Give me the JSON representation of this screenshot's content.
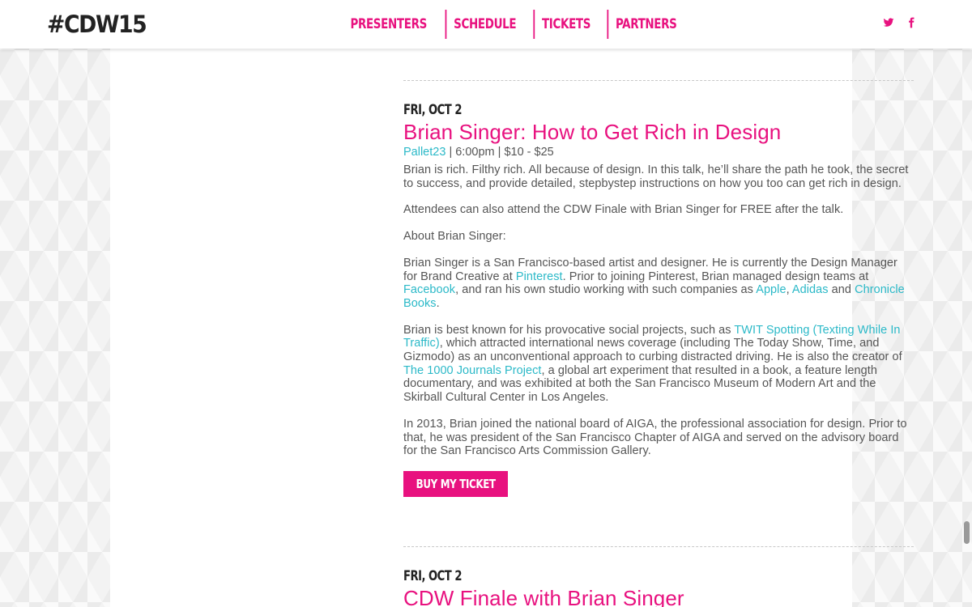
{
  "header": {
    "logo": "#CDW15",
    "nav": [
      "PRESENTERS",
      "SCHEDULE",
      "TICKETS",
      "PARTNERS"
    ],
    "social": [
      "twitter-icon",
      "facebook-icon"
    ]
  },
  "colors": {
    "accent": "#e8117f",
    "link": "#2bb9c8",
    "text": "#555555"
  },
  "events": [
    {
      "date": "FRI, OCT 2",
      "title": "Brian Singer: How to Get Rich in Design",
      "venue": "Pallet23",
      "time": "6:00pm",
      "price": "$10 - $25",
      "description_1": "Brian is rich. Filthy rich. All because of design. In this talk, he’ll share the path he took, the secret to success, and provide detailed, stepbystep instructions on how you too can get rich in design.",
      "description_2": "Attendees can also attend the CDW Finale with Brian Singer for FREE after the talk.",
      "about_heading": "About Brian Singer:",
      "bio_1": {
        "t1": "Brian Singer is a San Francisco-based artist and designer. He is currently the Design Manager for Brand Creative at ",
        "l1": "Pinterest",
        "t2": ". Prior to joining Pinterest, Brian managed design teams at ",
        "l2": "Facebook",
        "t3": ", and ran his own studio working with such companies as ",
        "l3": "Apple",
        "t4": ", ",
        "l4": "Adidas",
        "t5": " and ",
        "l5": "Chronicle Books",
        "t6": "."
      },
      "bio_2": {
        "t1": "Brian is best known for his provocative social projects, such as ",
        "l1": "TWIT Spotting (Texting While In Traffic)",
        "t2": ", which attracted international news coverage (including The Today Show, Time, and Gizmodo) as an unconventional approach to curbing distracted driving. He is also the creator of ",
        "l2": "The 1000 Journals Project",
        "t3": ", a global art experiment that resulted in a book, a feature length documentary, and was exhibited at both the San Francisco Museum of Modern Art and the Skirball Cultural Center in Los Angeles."
      },
      "bio_3": "In 2013, Brian joined the national board of AIGA, the professional association for design. Prior to that, he was president of the San Francisco Chapter of AIGA and served on the advisory board for the San Francisco Arts Commission Gallery.",
      "button": "BUY MY TICKET"
    },
    {
      "date": "FRI, OCT 2",
      "title": "CDW Finale with Brian Singer"
    }
  ]
}
